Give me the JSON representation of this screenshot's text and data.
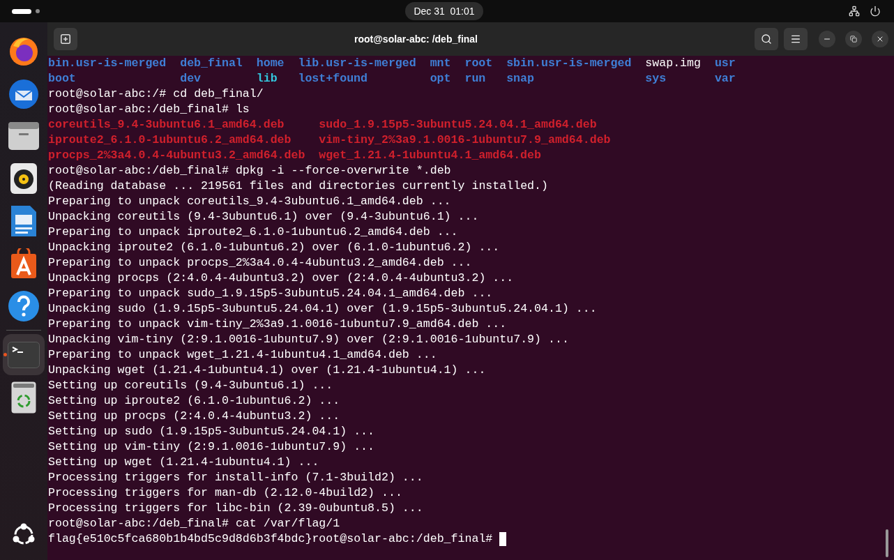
{
  "top_bar": {
    "clock": "Dec 31  01:01"
  },
  "dock": {
    "items": [
      {
        "kind": "firefox",
        "running": false
      },
      {
        "kind": "thunderbird",
        "running": false
      },
      {
        "kind": "files",
        "running": false
      },
      {
        "kind": "rhythmbox",
        "running": false
      },
      {
        "kind": "writer",
        "running": false
      },
      {
        "kind": "appcenter",
        "running": false
      },
      {
        "kind": "help",
        "running": false
      },
      {
        "kind": "terminal",
        "running": true
      },
      {
        "kind": "trash",
        "running": false
      }
    ]
  },
  "window": {
    "title": "root@solar-abc: /deb_final"
  },
  "terminal": {
    "lines": [
      {
        "kind": "ls",
        "rows": [
          [
            {
              "text": "bin.usr-is-merged",
              "kind": "dir"
            },
            {
              "text": "deb_final",
              "kind": "dir"
            },
            {
              "text": "home",
              "kind": "dir"
            },
            {
              "text": "lib.usr-is-merged",
              "kind": "dir"
            },
            {
              "text": "mnt",
              "kind": "dir"
            },
            {
              "text": "root",
              "kind": "dir"
            },
            {
              "text": "sbin.usr-is-merged",
              "kind": "dir"
            },
            {
              "text": "swap.img",
              "kind": "file"
            },
            {
              "text": "usr",
              "kind": "dir"
            }
          ],
          [
            {
              "text": "boot",
              "kind": "dir"
            },
            {
              "text": "dev",
              "kind": "dir"
            },
            {
              "text": "lib",
              "kind": "link"
            },
            {
              "text": "lost+found",
              "kind": "dir"
            },
            {
              "text": "opt",
              "kind": "dir"
            },
            {
              "text": "run",
              "kind": "dir"
            },
            {
              "text": "snap",
              "kind": "dir"
            },
            {
              "text": "sys",
              "kind": "dir"
            },
            {
              "text": "var",
              "kind": "dir"
            }
          ]
        ]
      },
      {
        "kind": "prompt",
        "prompt": "root@solar-abc:/#",
        "command": "cd deb_final/"
      },
      {
        "kind": "prompt",
        "prompt": "root@solar-abc:/deb_final#",
        "command": "ls"
      },
      {
        "kind": "ls",
        "rows": [
          [
            {
              "text": "coreutils_9.4-3ubuntu6.1_amd64.deb",
              "kind": "package"
            },
            {
              "text": "sudo_1.9.15p5-3ubuntu5.24.04.1_amd64.deb",
              "kind": "package"
            }
          ],
          [
            {
              "text": "iproute2_6.1.0-1ubuntu6.2_amd64.deb",
              "kind": "package"
            },
            {
              "text": "vim-tiny_2%3a9.1.0016-1ubuntu7.9_amd64.deb",
              "kind": "package"
            }
          ],
          [
            {
              "text": "procps_2%3a4.0.4-4ubuntu3.2_amd64.deb",
              "kind": "package"
            },
            {
              "text": "wget_1.21.4-1ubuntu4.1_amd64.deb",
              "kind": "package"
            }
          ]
        ]
      },
      {
        "kind": "prompt",
        "prompt": "root@solar-abc:/deb_final#",
        "command": "dpkg -i --force-overwrite *.deb"
      },
      {
        "kind": "output",
        "text": "(Reading database ... 219561 files and directories currently installed.)"
      },
      {
        "kind": "output",
        "text": "Preparing to unpack coreutils_9.4-3ubuntu6.1_amd64.deb ..."
      },
      {
        "kind": "output",
        "text": "Unpacking coreutils (9.4-3ubuntu6.1) over (9.4-3ubuntu6.1) ..."
      },
      {
        "kind": "output",
        "text": "Preparing to unpack iproute2_6.1.0-1ubuntu6.2_amd64.deb ..."
      },
      {
        "kind": "output",
        "text": "Unpacking iproute2 (6.1.0-1ubuntu6.2) over (6.1.0-1ubuntu6.2) ..."
      },
      {
        "kind": "output",
        "text": "Preparing to unpack procps_2%3a4.0.4-4ubuntu3.2_amd64.deb ..."
      },
      {
        "kind": "output",
        "text": "Unpacking procps (2:4.0.4-4ubuntu3.2) over (2:4.0.4-4ubuntu3.2) ..."
      },
      {
        "kind": "output",
        "text": "Preparing to unpack sudo_1.9.15p5-3ubuntu5.24.04.1_amd64.deb ..."
      },
      {
        "kind": "output",
        "text": "Unpacking sudo (1.9.15p5-3ubuntu5.24.04.1) over (1.9.15p5-3ubuntu5.24.04.1) ..."
      },
      {
        "kind": "output",
        "text": "Preparing to unpack vim-tiny_2%3a9.1.0016-1ubuntu7.9_amd64.deb ..."
      },
      {
        "kind": "output",
        "text": "Unpacking vim-tiny (2:9.1.0016-1ubuntu7.9) over (2:9.1.0016-1ubuntu7.9) ..."
      },
      {
        "kind": "output",
        "text": "Preparing to unpack wget_1.21.4-1ubuntu4.1_amd64.deb ..."
      },
      {
        "kind": "output",
        "text": "Unpacking wget (1.21.4-1ubuntu4.1) over (1.21.4-1ubuntu4.1) ..."
      },
      {
        "kind": "output",
        "text": "Setting up coreutils (9.4-3ubuntu6.1) ..."
      },
      {
        "kind": "output",
        "text": "Setting up iproute2 (6.1.0-1ubuntu6.2) ..."
      },
      {
        "kind": "output",
        "text": "Setting up procps (2:4.0.4-4ubuntu3.2) ..."
      },
      {
        "kind": "output",
        "text": "Setting up sudo (1.9.15p5-3ubuntu5.24.04.1) ..."
      },
      {
        "kind": "output",
        "text": "Setting up vim-tiny (2:9.1.0016-1ubuntu7.9) ..."
      },
      {
        "kind": "output",
        "text": "Setting up wget (1.21.4-1ubuntu4.1) ..."
      },
      {
        "kind": "output",
        "text": "Processing triggers for install-info (7.1-3build2) ..."
      },
      {
        "kind": "output",
        "text": "Processing triggers for man-db (2.12.0-4build2) ..."
      },
      {
        "kind": "output",
        "text": "Processing triggers for libc-bin (2.39-0ubuntu8.5) ..."
      },
      {
        "kind": "prompt",
        "prompt": "root@solar-abc:/deb_final#",
        "command": "cat /var/flag/1"
      },
      {
        "kind": "output_prompt",
        "text": "flag{e510c5fca680b1b4bd5c9d8d6b3f4bdc}",
        "prompt": "root@solar-abc:/deb_final#"
      }
    ]
  }
}
